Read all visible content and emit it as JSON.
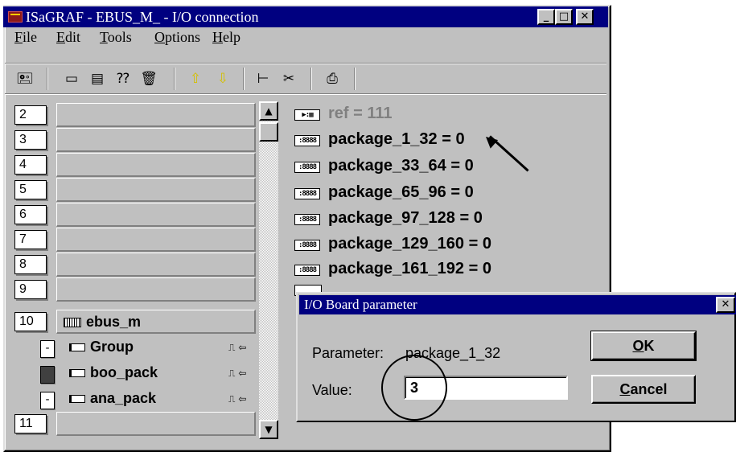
{
  "window": {
    "title": "ISaGRAF - EBUS_M_ - I/O connection",
    "controls": [
      "_",
      "□",
      "✕"
    ]
  },
  "menu": [
    {
      "key": "F",
      "rest": "ile"
    },
    {
      "key": "E",
      "rest": "dit"
    },
    {
      "key": "T",
      "rest": "ools"
    },
    {
      "key": "O",
      "rest": "ptions"
    },
    {
      "key": "H",
      "rest": "elp"
    }
  ],
  "toolbar_icons": [
    "open-board-icon",
    "connect-icon",
    "list-icon",
    "help-icon",
    "delete-icon",
    "up-arrow-icon",
    "down-arrow-icon",
    "tree-icon",
    "cut-icon",
    "print-icon"
  ],
  "slots": [
    {
      "num": "2",
      "label": ""
    },
    {
      "num": "3",
      "label": ""
    },
    {
      "num": "4",
      "label": ""
    },
    {
      "num": "5",
      "label": ""
    },
    {
      "num": "6",
      "label": ""
    },
    {
      "num": "7",
      "label": ""
    },
    {
      "num": "8",
      "label": ""
    },
    {
      "num": "9",
      "label": ""
    },
    {
      "num": "10",
      "label": "ebus_m"
    }
  ],
  "channels": [
    {
      "mark": "-",
      "label": "Group",
      "tail": "⎍ ⇦"
    },
    {
      "mark": "",
      "label": "boo_pack",
      "tail": "⎍ ⇦"
    },
    {
      "mark": "-",
      "label": "ana_pack",
      "tail": "⎍ ⇦"
    }
  ],
  "last_slot": {
    "num": "11",
    "label": ""
  },
  "variables": [
    {
      "icon": "▶:▦",
      "text": "ref = 111",
      "muted": true
    },
    {
      "icon": ":8888",
      "text": "package_1_32 = 0",
      "muted": false
    },
    {
      "icon": ":8888",
      "text": "package_33_64 = 0",
      "muted": false
    },
    {
      "icon": ":8888",
      "text": "package_65_96 = 0",
      "muted": false
    },
    {
      "icon": ":8888",
      "text": "package_97_128 = 0",
      "muted": false
    },
    {
      "icon": ":8888",
      "text": "package_129_160 = 0",
      "muted": false
    },
    {
      "icon": ":8888",
      "text": "package_161_192 = 0",
      "muted": false
    }
  ],
  "dialog": {
    "title": "I/O Board parameter",
    "parameter_label": "Parameter:",
    "parameter_value": "package_1_32",
    "value_label": "Value:",
    "value_input": "3",
    "ok_key": "O",
    "ok_rest": "K",
    "cancel_key": "C",
    "cancel_rest": "ancel",
    "close": "✕"
  }
}
